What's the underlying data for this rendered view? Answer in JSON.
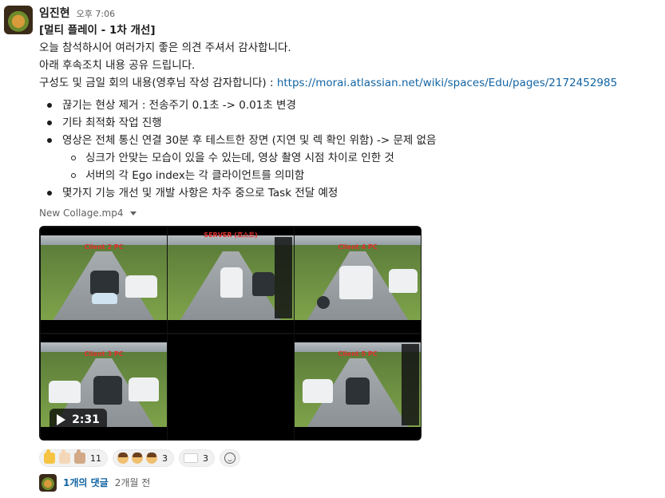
{
  "message": {
    "author": "임진현",
    "time": "오후 7:06",
    "title": "[멀티 플레이 - 1차 개선]",
    "lines": [
      "오늘 참석하시어 여러가지 좋은 의견 주셔서 감사합니다.",
      "아래 후속조치 내용 공유 드립니다."
    ],
    "doc_line_prefix": "구성도 및 금일 회의 내용(영후님 작성 감자합니다) : ",
    "doc_link": "https://morai.atlassian.net/wiki/spaces/Edu/pages/2172452985",
    "bullets": [
      "끊기는 현상 제거 : 전송주기 0.1초 -> 0.01초 변경",
      "기타 최적화 작업 진행",
      "영상은 전체 통신 연결 30분 후 테스트한 장면 (지연 및 렉 확인 위함) -> 문제 없음"
    ],
    "sub_bullets": [
      "싱크가 안맞는 모습이 있을 수 있는데, 영상 촬영 시점 차이로 인한 것",
      "서버의 각 Ego index는 각 클라이언트를 의미함"
    ],
    "last_bullet": "몇가지 기능 개선 및 개발 사항은 차주 중으로 Task 전달 예정"
  },
  "attachment": {
    "filename": "New Collage.mp4",
    "duration": "2:31",
    "tiles": {
      "client2": "Client 2 PC",
      "server": "SERVER (호스트)",
      "client4": "Client 4 PC",
      "client3": "Client 3 PC",
      "client5": "Client 5 PC"
    }
  },
  "reactions": [
    {
      "emojis": [
        "thumbs-up-yellow",
        "thumbs-up-light",
        "thumbs-up-medium"
      ],
      "count": "11"
    },
    {
      "emojis": [
        "bowing-person",
        "bowing-person",
        "bowing-person"
      ],
      "count": "3"
    },
    {
      "emojis": [
        "custom-tag-emoji"
      ],
      "count": "3"
    }
  ],
  "thread": {
    "replies": "1개의 댓글",
    "last_reply": "2개월 전"
  },
  "colors": {
    "link": "#1264a3",
    "text": "#1d1c1d",
    "muted": "#616061",
    "label_red": "#e23030"
  }
}
